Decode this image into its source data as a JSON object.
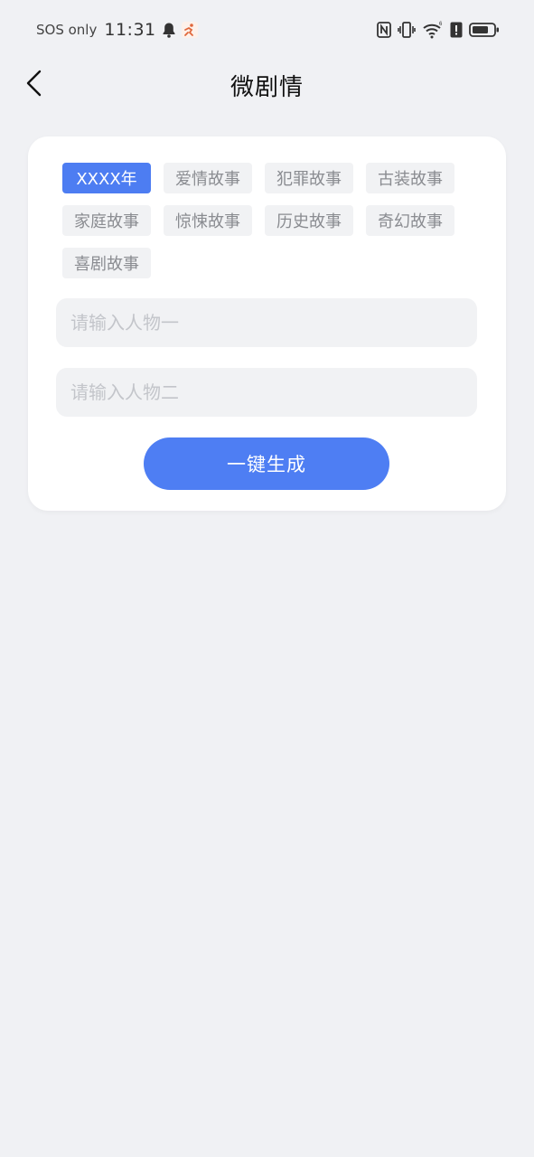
{
  "status_bar": {
    "carrier": "SOS only",
    "time": "11:31",
    "icons": [
      "bell-icon",
      "running-app-icon",
      "nfc-icon",
      "vibrate-icon",
      "wifi-icon",
      "alert-icon",
      "battery-icon"
    ]
  },
  "header": {
    "title": "微剧情",
    "back_icon": "back-arrow-icon"
  },
  "genres": {
    "items": [
      {
        "label": "XXXX年",
        "selected": true
      },
      {
        "label": "爱情故事",
        "selected": false
      },
      {
        "label": "犯罪故事",
        "selected": false
      },
      {
        "label": "古装故事",
        "selected": false
      },
      {
        "label": "家庭故事",
        "selected": false
      },
      {
        "label": "惊悚故事",
        "selected": false
      },
      {
        "label": "历史故事",
        "selected": false
      },
      {
        "label": "奇幻故事",
        "selected": false
      },
      {
        "label": "喜剧故事",
        "selected": false
      }
    ]
  },
  "form": {
    "character_one": {
      "value": "",
      "placeholder": "请输入人物一"
    },
    "character_two": {
      "value": "",
      "placeholder": "请输入人物二"
    },
    "generate_label": "一键生成"
  },
  "colors": {
    "accent": "#4e7ef3",
    "background": "#f0f1f4",
    "tag_background": "#f1f2f4",
    "tag_text": "#8a8c91",
    "placeholder": "#c3c5ca"
  }
}
